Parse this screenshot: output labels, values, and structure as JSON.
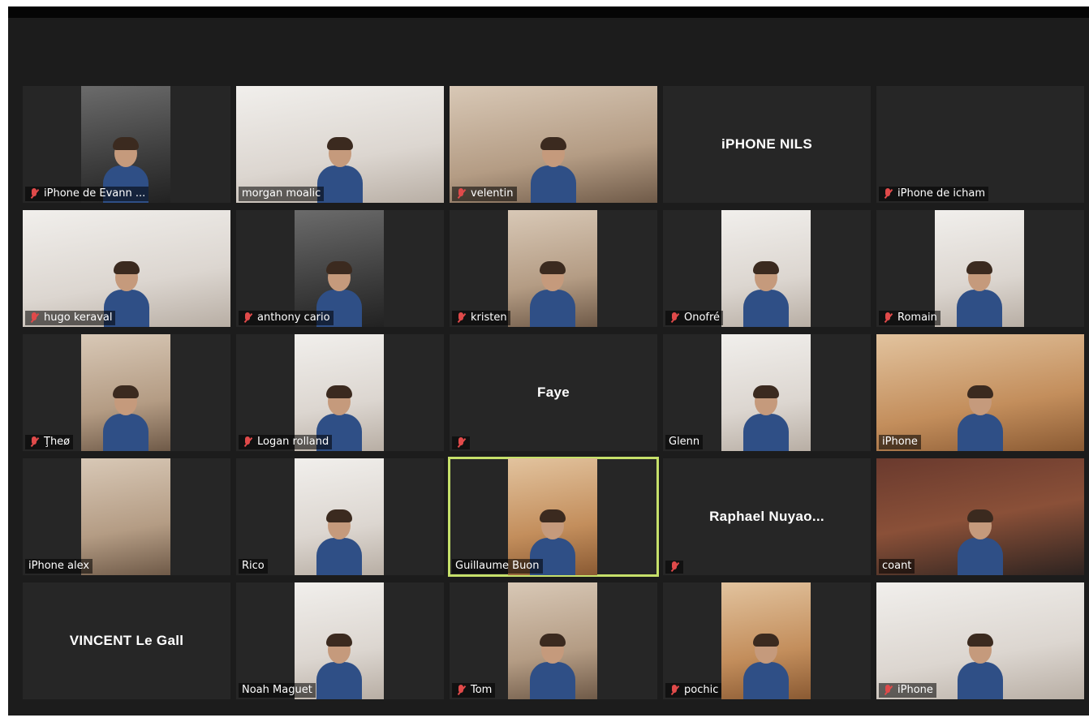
{
  "participants": [
    {
      "name": "iPhone de Evann ...",
      "muted": true,
      "video": "mid",
      "bg": "bg-dark",
      "person": true
    },
    {
      "name": "morgan moalic",
      "muted": false,
      "video": "wide",
      "bg": "bg-white",
      "person": true
    },
    {
      "name": "velentin",
      "muted": true,
      "video": "wide",
      "bg": "bg-warm",
      "person": true
    },
    {
      "name": "",
      "display_name": "iPHONE NILS",
      "muted": false,
      "video": "none",
      "bg": "",
      "person": false
    },
    {
      "name": "iPhone de icham",
      "muted": true,
      "video": "none",
      "bg": "",
      "person": false
    },
    {
      "name": "hugo keraval",
      "muted": true,
      "video": "wide",
      "bg": "bg-white",
      "person": true
    },
    {
      "name": "anthony cario",
      "muted": true,
      "video": "mid",
      "bg": "bg-dark",
      "person": true
    },
    {
      "name": "kristen",
      "muted": true,
      "video": "mid",
      "bg": "bg-warm",
      "person": true
    },
    {
      "name": "Onofré",
      "muted": true,
      "video": "mid",
      "bg": "bg-white",
      "person": true
    },
    {
      "name": "Romain",
      "muted": true,
      "video": "mid",
      "bg": "bg-white",
      "person": true
    },
    {
      "name": "Ţheø",
      "muted": true,
      "video": "mid",
      "bg": "bg-warm",
      "person": true
    },
    {
      "name": "Logan rolland",
      "muted": true,
      "video": "mid",
      "bg": "bg-white",
      "person": true
    },
    {
      "name": "",
      "display_name": "Faye",
      "muted": true,
      "video": "none",
      "bg": "",
      "person": false
    },
    {
      "name": "Glenn",
      "muted": false,
      "video": "mid",
      "bg": "bg-white",
      "person": true
    },
    {
      "name": "iPhone",
      "muted": false,
      "video": "wide",
      "bg": "bg-orange",
      "person": true
    },
    {
      "name": "iPhone alex",
      "muted": false,
      "video": "mid",
      "bg": "bg-warm",
      "person": false
    },
    {
      "name": "Rico",
      "muted": false,
      "video": "mid",
      "bg": "bg-white",
      "person": true
    },
    {
      "name": "Guillaume Buon",
      "muted": false,
      "video": "mid",
      "bg": "bg-orange",
      "person": true,
      "active": true
    },
    {
      "name": "",
      "display_name": "Raphael  Nuyao...",
      "muted": true,
      "video": "none",
      "bg": "",
      "person": false
    },
    {
      "name": "coant",
      "muted": false,
      "video": "wide",
      "bg": "bg-red",
      "person": true
    },
    {
      "name": "",
      "display_name": "VINCENT Le Gall",
      "muted": false,
      "video": "none",
      "bg": "",
      "person": false
    },
    {
      "name": "Noah Maguet",
      "muted": false,
      "video": "mid",
      "bg": "bg-white",
      "person": true
    },
    {
      "name": "Tom",
      "muted": true,
      "video": "mid",
      "bg": "bg-warm",
      "person": true
    },
    {
      "name": "pochic",
      "muted": true,
      "video": "mid",
      "bg": "bg-orange",
      "person": true
    },
    {
      "name": "iPhone",
      "muted": true,
      "video": "wide",
      "bg": "bg-white",
      "person": true
    }
  ],
  "icons": {
    "muted_mic": "mic-muted-icon"
  },
  "colors": {
    "background": "#1c1c1c",
    "tile": "#262626",
    "active_speaker": "#c6e06a",
    "muted": "#e04a4a"
  }
}
